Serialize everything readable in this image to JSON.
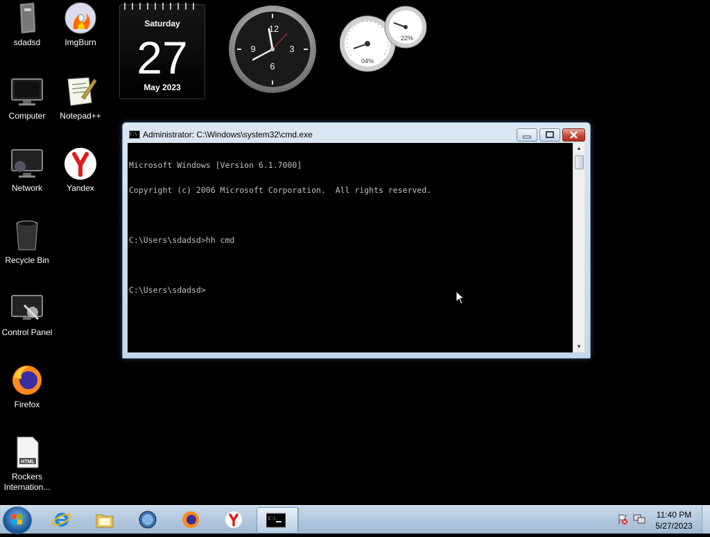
{
  "desktop": {
    "icons": [
      {
        "label": "sdadsd",
        "icon": "user-folder-icon"
      },
      {
        "label": "Computer",
        "icon": "computer-icon"
      },
      {
        "label": "Network",
        "icon": "network-icon"
      },
      {
        "label": "Recycle Bin",
        "icon": "recycle-bin-icon"
      },
      {
        "label": "Control Panel",
        "icon": "control-panel-icon"
      },
      {
        "label": "Firefox",
        "icon": "firefox-icon"
      },
      {
        "label": "Rockers Internation...",
        "icon": "html-file-icon"
      },
      {
        "label": "ImgBurn",
        "icon": "imgburn-icon"
      },
      {
        "label": "Notepad++",
        "icon": "notepadpp-icon"
      },
      {
        "label": "Yandex",
        "icon": "yandex-icon"
      }
    ]
  },
  "gadgets": {
    "calendar": {
      "weekday": "Saturday",
      "day": "27",
      "month_year": "May 2023"
    },
    "clock": {
      "numerals": [
        "12",
        "3",
        "6",
        "9"
      ]
    },
    "meter": {
      "cpu": "04%",
      "memory": "22%"
    }
  },
  "cmd_window": {
    "title": "Administrator: C:\\Windows\\system32\\cmd.exe",
    "icon_text": "C:\\",
    "lines": [
      "Microsoft Windows [Version 6.1.7000]",
      "Copyright (c) 2006 Microsoft Corporation.  All rights reserved.",
      "",
      "C:\\Users\\sdadsd>hh cmd",
      "",
      "C:\\Users\\sdadsd>"
    ]
  },
  "taskbar": {
    "items": [
      {
        "name": "internet-explorer",
        "icon": "ie-icon"
      },
      {
        "name": "windows-explorer",
        "icon": "folder-icon"
      },
      {
        "name": "media",
        "icon": "globe-icon"
      },
      {
        "name": "firefox",
        "icon": "firefox-icon"
      },
      {
        "name": "yandex",
        "icon": "yandex-icon"
      },
      {
        "name": "cmd",
        "icon": "cmd-icon",
        "active": true
      }
    ],
    "time": "11:40 PM",
    "date": "5/27/2023"
  },
  "colors": {
    "desktop_bg": "#000000",
    "console_text": "#c0c0c0",
    "taskbar": "#b7cbe0"
  }
}
